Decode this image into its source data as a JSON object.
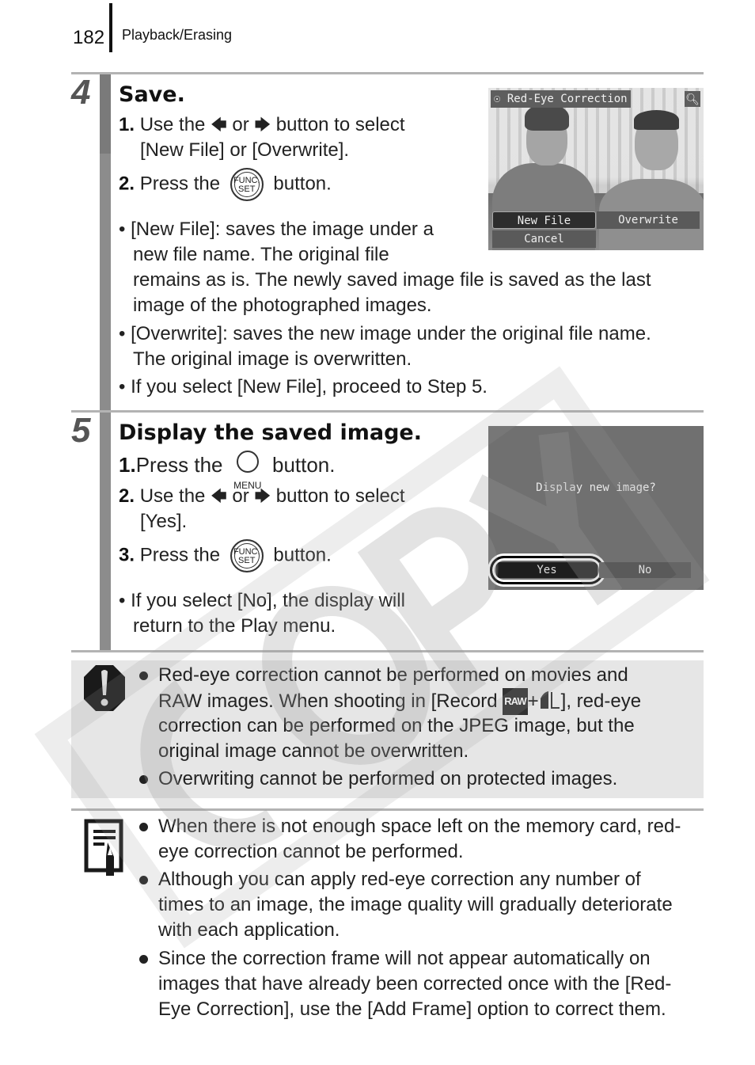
{
  "header": {
    "page_number": "182",
    "section": "Playback/Erasing"
  },
  "step4": {
    "number": "4",
    "title": "Save.",
    "items": [
      {
        "num": "1.",
        "text_a": "Use the",
        "text_or": "or",
        "text_b": "button to select",
        "cont": "[New File] or [Overwrite]."
      },
      {
        "num": "2.",
        "text_a": "Press the",
        "text_b": "button."
      }
    ],
    "bullets": [
      [
        "[New File]: saves the image under a",
        "new file name. The original file",
        "remains as is. The newly saved image file is saved as the last",
        "image of the photographed images."
      ],
      [
        "[Overwrite]: saves the new image under the original file name.",
        "The original image is overwritten."
      ],
      [
        "If you select [New File], proceed to Step 5."
      ]
    ],
    "screen": {
      "title": "Red-Eye Correction",
      "buttons": [
        "New File",
        "Overwrite",
        "Cancel"
      ],
      "selected": "New File"
    }
  },
  "step5": {
    "number": "5",
    "title": "Display the saved image.",
    "items": [
      {
        "num": "1.",
        "text_a": "Press the",
        "icon_label": "MENU",
        "text_b": "button."
      },
      {
        "num": "2.",
        "text_a": "Use the",
        "text_or": "or",
        "text_b": "button to select",
        "cont": "[Yes]."
      },
      {
        "num": "3.",
        "text_a": "Press the",
        "text_b": "button."
      }
    ],
    "bullets": [
      [
        "If you select [No], the display will",
        "return to the Play menu."
      ]
    ],
    "screen": {
      "question": "Display new image?",
      "buttons": [
        "Yes",
        "No"
      ],
      "selected": "Yes"
    }
  },
  "icons": {
    "func_top": "FUNC.",
    "func_bottom": "SET",
    "left_arrow": "◆",
    "raw": "RAW"
  },
  "caution": {
    "bullets": [
      [
        "Red-eye correction cannot be performed on movies and",
        "RAW images. When shooting in [Record",
        "], red-eye",
        "correction can be performed on the JPEG image, but the",
        "original image cannot be overwritten."
      ],
      [
        "Overwriting cannot be performed on protected images."
      ]
    ],
    "plus": "+"
  },
  "info": {
    "bullets": [
      [
        "When there is not enough space left on the memory card, red-",
        "eye correction cannot be performed."
      ],
      [
        "Although you can apply red-eye correction any number of",
        "times to an image, the image quality will gradually deteriorate",
        "with each application."
      ],
      [
        "Since the correction frame will not appear automatically on",
        "images that have already been corrected once with the [Red-",
        "Eye Correction], use the [Add Frame] option to correct them."
      ]
    ]
  },
  "watermark": "COPY"
}
